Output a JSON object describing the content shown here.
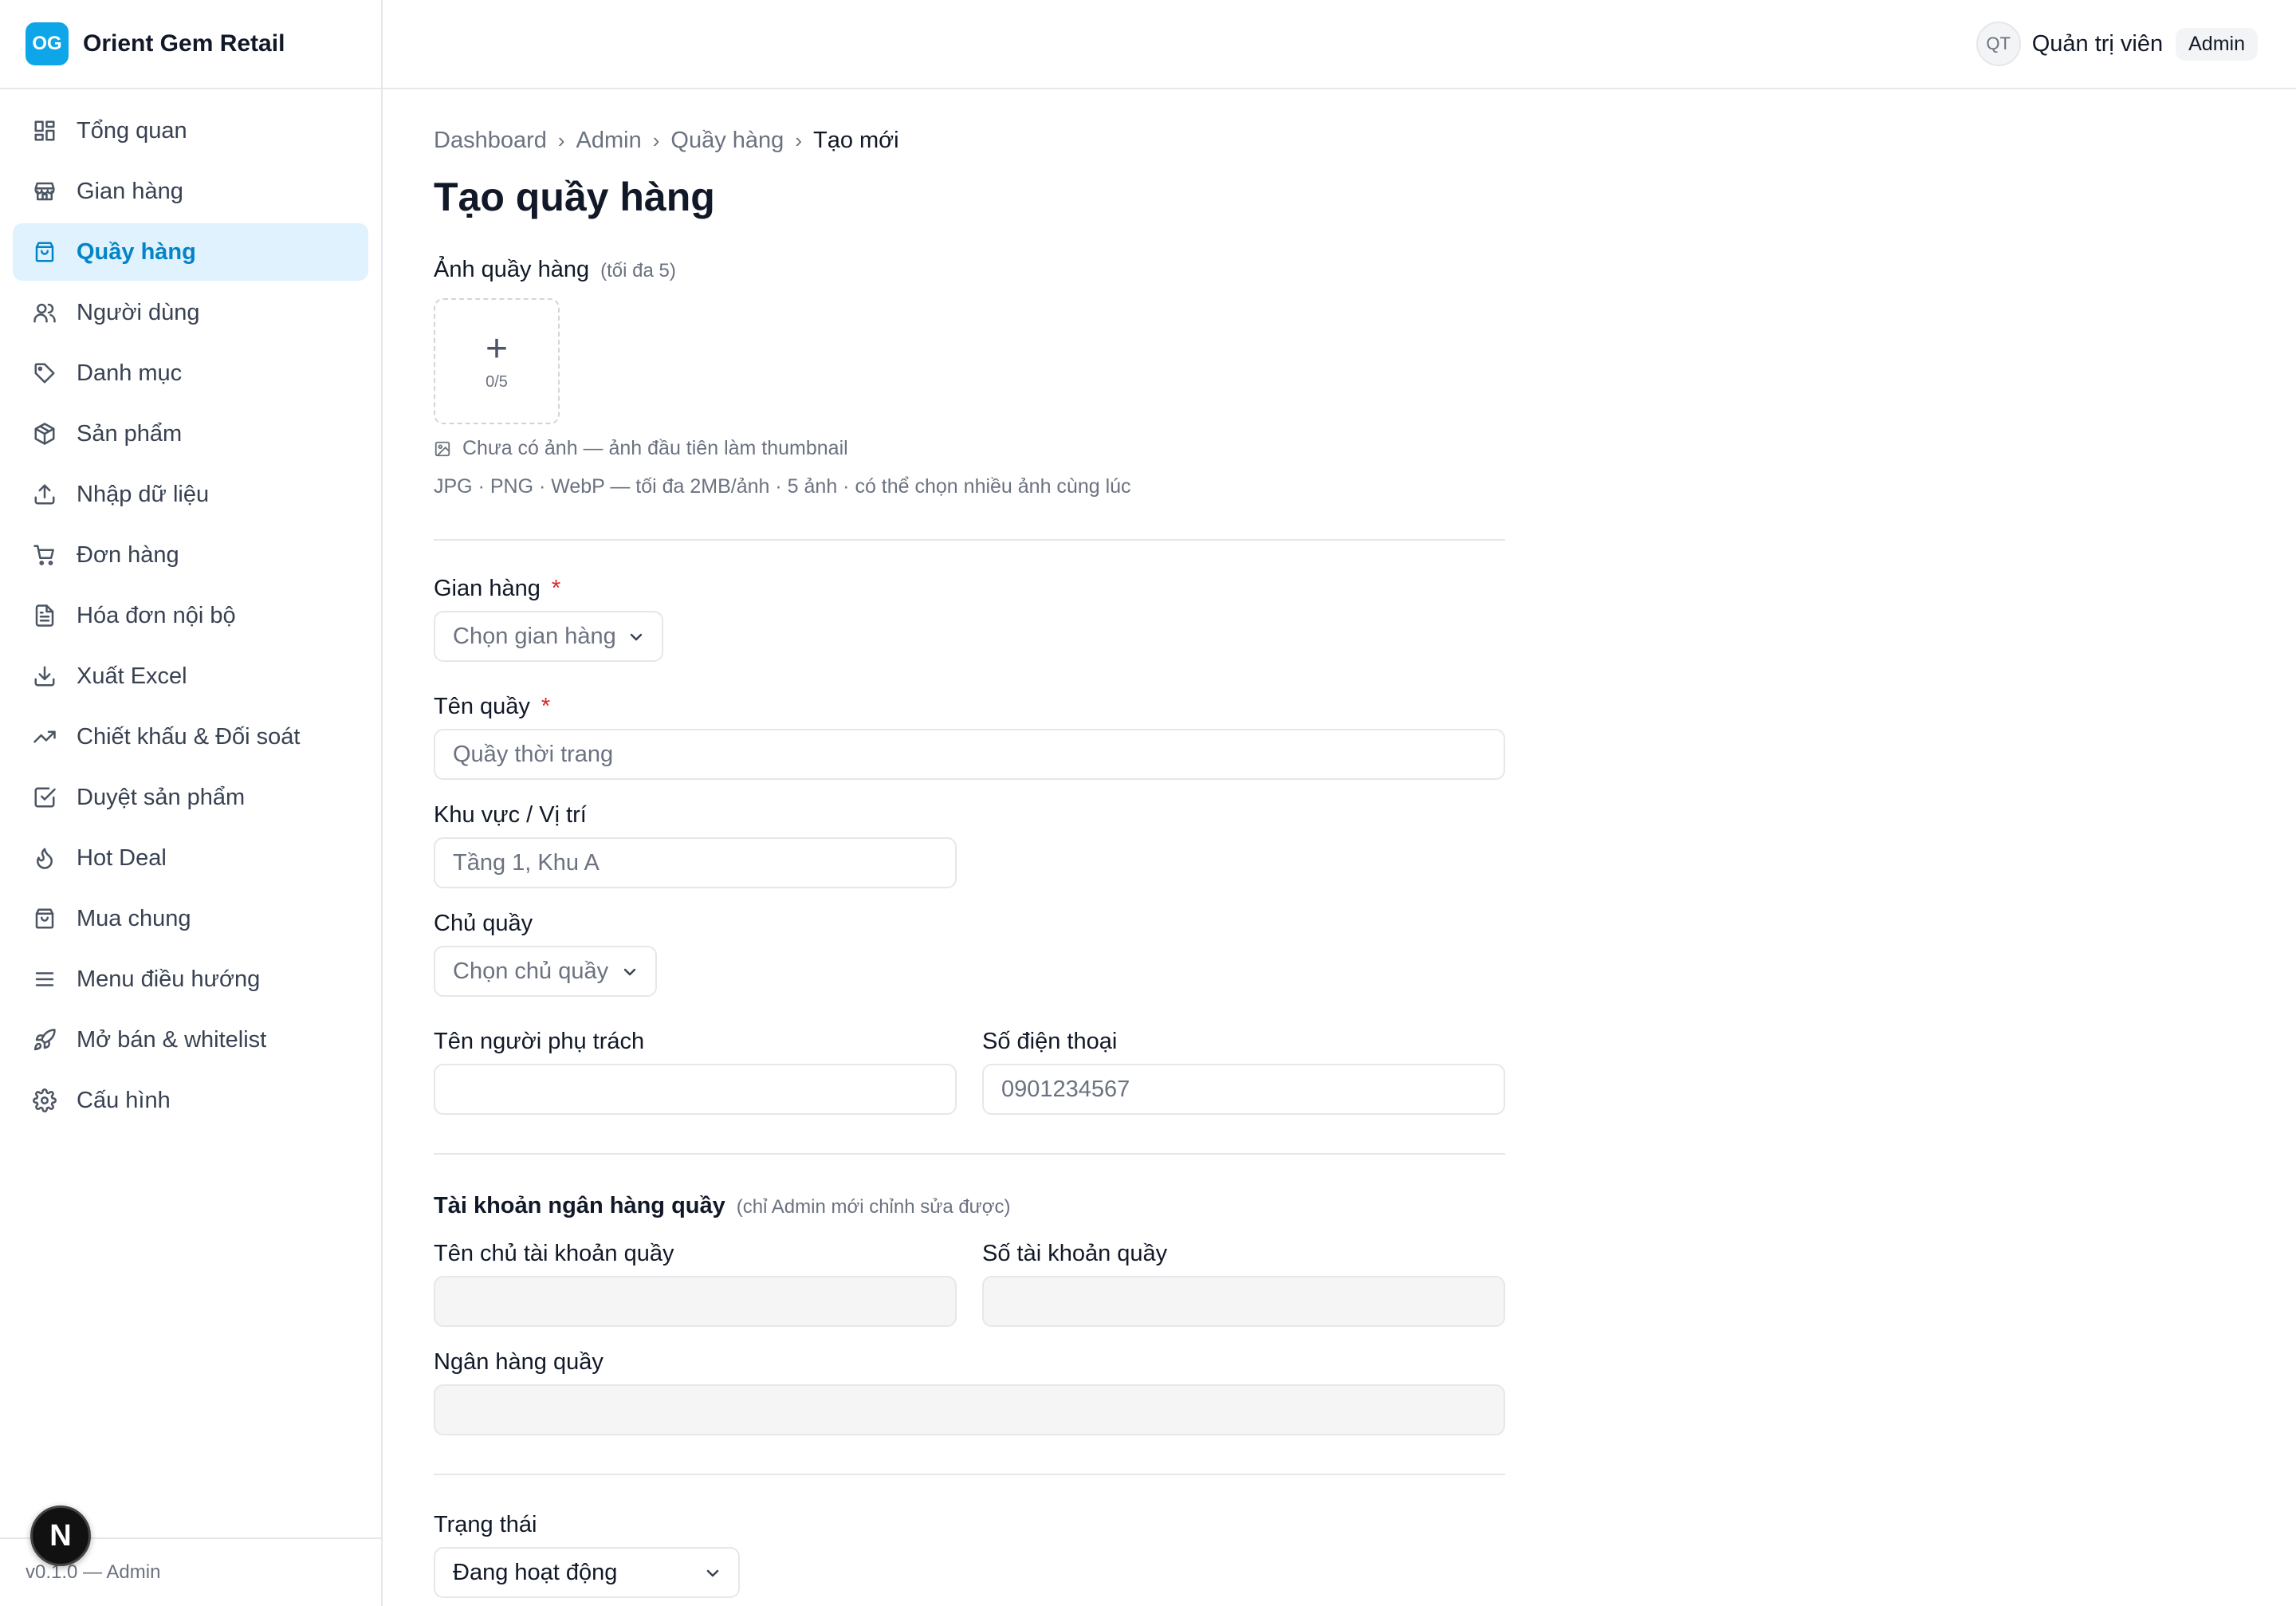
{
  "brand": {
    "logo_text": "OG",
    "name": "Orient Gem Retail",
    "color": "#0ea5e9"
  },
  "header": {
    "avatar_initials": "QT",
    "user_name": "Quản trị viên",
    "role": "Admin"
  },
  "sidebar": {
    "items": [
      {
        "label": "Tổng quan",
        "icon": "dashboard-icon",
        "active": false
      },
      {
        "label": "Gian hàng",
        "icon": "store-icon",
        "active": false
      },
      {
        "label": "Quầy hàng",
        "icon": "shopping-bag-icon",
        "active": true
      },
      {
        "label": "Người dùng",
        "icon": "users-icon",
        "active": false
      },
      {
        "label": "Danh mục",
        "icon": "tag-icon",
        "active": false
      },
      {
        "label": "Sản phẩm",
        "icon": "package-icon",
        "active": false
      },
      {
        "label": "Nhập dữ liệu",
        "icon": "upload-icon",
        "active": false
      },
      {
        "label": "Đơn hàng",
        "icon": "cart-icon",
        "active": false
      },
      {
        "label": "Hóa đơn nội bộ",
        "icon": "file-text-icon",
        "active": false
      },
      {
        "label": "Xuất Excel",
        "icon": "download-icon",
        "active": false
      },
      {
        "label": "Chiết khấu & Đối soát",
        "icon": "trending-up-icon",
        "active": false
      },
      {
        "label": "Duyệt sản phẩm",
        "icon": "check-square-icon",
        "active": false
      },
      {
        "label": "Hot Deal",
        "icon": "flame-icon",
        "active": false
      },
      {
        "label": "Mua chung",
        "icon": "shopping-bag-icon",
        "active": false
      },
      {
        "label": "Menu điều hướng",
        "icon": "menu-icon",
        "active": false
      },
      {
        "label": "Mở bán & whitelist",
        "icon": "rocket-icon",
        "active": false
      },
      {
        "label": "Cấu hình",
        "icon": "gear-icon",
        "active": false
      }
    ],
    "footer": "v0.1.0 — Admin",
    "next_badge": "N"
  },
  "breadcrumb": [
    "Dashboard",
    "Admin",
    "Quầy hàng",
    "Tạo mới"
  ],
  "page_title": "Tạo quầy hàng",
  "form": {
    "images": {
      "label": "Ảnh quầy hàng",
      "hint": "(tối đa 5)",
      "plus": "+",
      "count": "0/5",
      "empty_note": "Chưa có ảnh — ảnh đầu tiên làm thumbnail",
      "format_note": "JPG · PNG · WebP — tối đa 2MB/ảnh · 5 ảnh · có thể chọn nhiều ảnh cùng lúc"
    },
    "required_mark": "*",
    "stall": {
      "label": "Gian hàng",
      "value": "Chọn gian hàng"
    },
    "name": {
      "label": "Tên quầy",
      "placeholder": "Quầy thời trang",
      "value": ""
    },
    "location": {
      "label": "Khu vực / Vị trí",
      "placeholder": "Tầng 1, Khu A",
      "value": ""
    },
    "owner": {
      "label": "Chủ quầy",
      "value": "Chọn chủ quầy"
    },
    "contact_name": {
      "label": "Tên người phụ trách",
      "placeholder": "",
      "value": ""
    },
    "phone": {
      "label": "Số điện thoại",
      "placeholder": "0901234567",
      "value": ""
    },
    "bank_section": {
      "title": "Tài khoản ngân hàng quầy",
      "hint": "(chỉ Admin mới chỉnh sửa được)"
    },
    "account_holder": {
      "label": "Tên chủ tài khoản quầy"
    },
    "account_number": {
      "label": "Số tài khoản quầy"
    },
    "bank_name": {
      "label": "Ngân hàng quầy"
    },
    "status": {
      "label": "Trạng thái",
      "value": "Đang hoạt động"
    }
  }
}
